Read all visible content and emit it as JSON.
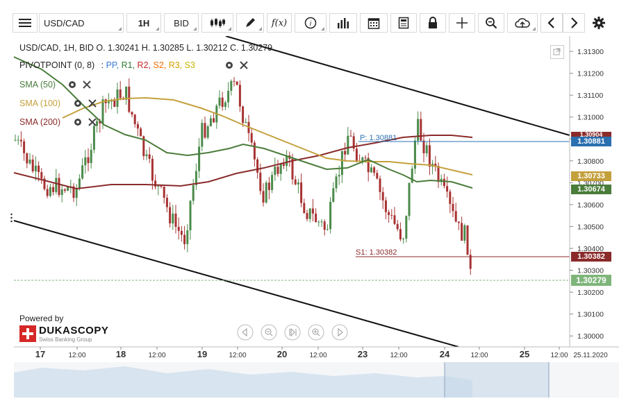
{
  "toolbar": {
    "menu_icon": "hamburger-menu-icon",
    "symbol": "USD/CAD",
    "timeframe": "1H",
    "side": "BID",
    "buttons": [
      "candlestick-icon",
      "pencil-icon",
      "function-icon",
      "info-icon",
      "bar-chart-icon",
      "calendar-icon",
      "document-icon",
      "lock-icon",
      "crosshair-icon",
      "zoom-icon",
      "cloud-upload-icon",
      "chevron-left-icon",
      "chevron-right-icon",
      "gear-icon"
    ],
    "function_label": "f(x)"
  },
  "ohlc": "USD/CAD, 1H, BID   O. 1.30241 H. 1.30285 L. 1.30212 C. 1.30279",
  "indicators": {
    "pivot": {
      "name": "PIVOTPOINT (0, 8)",
      "sep": ":",
      "items": [
        "PP,",
        "R1,",
        "R2,",
        "S2,",
        "R3,",
        "S3"
      ],
      "colors": [
        "#3a7bd5",
        "#2e7d32",
        "#c62828",
        "#ef6c00",
        "#d4a000",
        "#c7b400"
      ]
    },
    "sma50": {
      "label": "SMA (50)",
      "color": "#4a7c3a"
    },
    "sma100": {
      "label": "SMA (100)",
      "color": "#c4a03c"
    },
    "sma200": {
      "label": "SMA (200)",
      "color": "#8b2a2a"
    }
  },
  "pivot_labels": {
    "pp": "P: 1.30881",
    "s1": "S1: 1.30382"
  },
  "y_ticks": [
    "1.31300",
    "1.31200",
    "1.31100",
    "1.31000",
    "1.30900",
    "1.30800",
    "1.30700",
    "1.30600",
    "1.30500",
    "1.30400",
    "1.30300",
    "1.30200",
    "1.30100",
    "1.30000"
  ],
  "y_tick_values": [
    1.313,
    1.312,
    1.311,
    1.31,
    1.309,
    1.308,
    1.307,
    1.306,
    1.305,
    1.304,
    1.303,
    1.302,
    1.301,
    1.3
  ],
  "price_tags": [
    {
      "value": "1.30881",
      "color": "#2a6fb0"
    },
    {
      "value": "1.30733",
      "color": "#c4a03c"
    },
    {
      "value": "1.30674",
      "color": "#4a7c3a"
    },
    {
      "value": "1.30382",
      "color": "#8b2a2a"
    },
    {
      "value": "1.30279",
      "color": "#7fb57a"
    },
    {
      "value": "1.30904",
      "color": "#8b2a2a"
    }
  ],
  "x_labels": [
    {
      "text": "17",
      "bold": true
    },
    {
      "text": "12:00",
      "bold": false
    },
    {
      "text": "18",
      "bold": true
    },
    {
      "text": "12:00",
      "bold": false
    },
    {
      "text": "19",
      "bold": true
    },
    {
      "text": "12:00",
      "bold": false
    },
    {
      "text": "20",
      "bold": true
    },
    {
      "text": "12:00",
      "bold": false
    },
    {
      "text": "23",
      "bold": true
    },
    {
      "text": "12:00",
      "bold": false
    },
    {
      "text": "24",
      "bold": true
    },
    {
      "text": "12:00",
      "bold": false
    },
    {
      "text": "25",
      "bold": true
    },
    {
      "text": "12:00",
      "bold": false
    }
  ],
  "date_corner": "25.11.2020",
  "branding": {
    "powered": "Powered by",
    "name": "DUKASCOPY",
    "tagline": "Swiss Banking Group"
  },
  "nav_buttons": [
    "nav-left-icon",
    "zoom-out-icon",
    "reset-zoom-icon",
    "zoom-in-icon",
    "nav-right-icon"
  ],
  "colors": {
    "bull": "#4a8a4a",
    "bear": "#a83232",
    "pp_line": "#2a6fb0",
    "s1_line": "#8b2a2a"
  },
  "chart_data": {
    "type": "candlestick",
    "ylim": [
      1.2995,
      1.3137
    ],
    "last_close": 1.30279
  }
}
